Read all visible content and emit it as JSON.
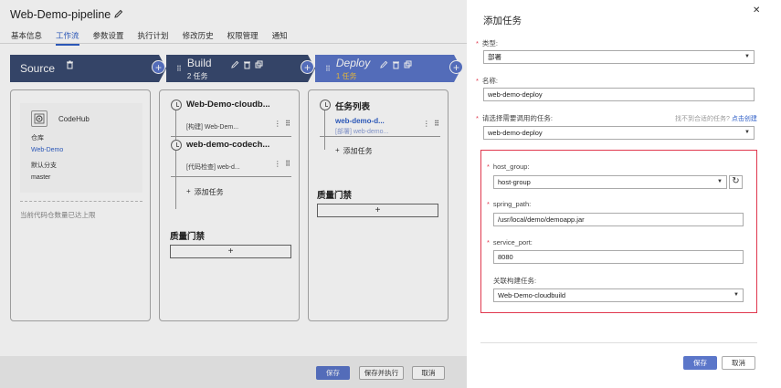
{
  "page": {
    "title": "Web-Demo-pipeline",
    "tabs": [
      {
        "label": "基本信息",
        "active": false
      },
      {
        "label": "工作流",
        "active": true
      },
      {
        "label": "参数设置",
        "active": false
      },
      {
        "label": "执行计划",
        "active": false
      },
      {
        "label": "修改历史",
        "active": false
      },
      {
        "label": "权限管理",
        "active": false
      },
      {
        "label": "通知",
        "active": false
      }
    ]
  },
  "stages": {
    "source": {
      "name": "Source",
      "codehub": {
        "name": "CodeHub",
        "repo_label": "仓库",
        "repo_value": "Web-Demo",
        "branch_label": "默认分支",
        "branch_value": "master"
      },
      "note": "当前代码仓数量已达上限"
    },
    "build": {
      "name": "Build",
      "count": "2 任务",
      "tasks": [
        {
          "name": "Web-Demo-cloudb...",
          "sub": "[构建] Web-Dem..."
        },
        {
          "name": "web-demo-codech...",
          "sub": "[代码检查] web-d..."
        }
      ],
      "add_task": "添加任务",
      "gate": "质量门禁"
    },
    "deploy": {
      "name": "Deploy",
      "count": "1 任务",
      "list_title": "任务列表",
      "task_link": "web-demo-d...",
      "task_sub": "[部署] web-demo...",
      "add_task": "添加任务",
      "gate": "质量门禁"
    }
  },
  "bottom": {
    "save": "保存",
    "save_run": "保存并执行",
    "cancel": "取消"
  },
  "drawer": {
    "title": "添加任务",
    "type_label": "类型:",
    "type_value": "部署",
    "name_label": "名称:",
    "name_value": "web-demo-deploy",
    "task_label": "请选择需要调用的任务:",
    "task_hint": "找不到合适的任务?",
    "task_hint_link": "点击创建",
    "task_value": "web-demo-deploy",
    "host_group_label": "host_group:",
    "host_group_value": "host-group",
    "spring_path_label": "spring_path:",
    "spring_path_value": "/usr/local/demo/demoapp.jar",
    "service_port_label": "service_port:",
    "service_port_value": "8080",
    "related_build_label": "关联构建任务:",
    "related_build_value": "Web-Demo-cloudbuild",
    "save": "保存",
    "cancel": "取消"
  },
  "colors": {
    "stage_dark": "#394a70",
    "stage_active": "#5b76c9",
    "primary": "#5b76c9",
    "required": "#e0384e",
    "link": "#2f5fc7"
  }
}
